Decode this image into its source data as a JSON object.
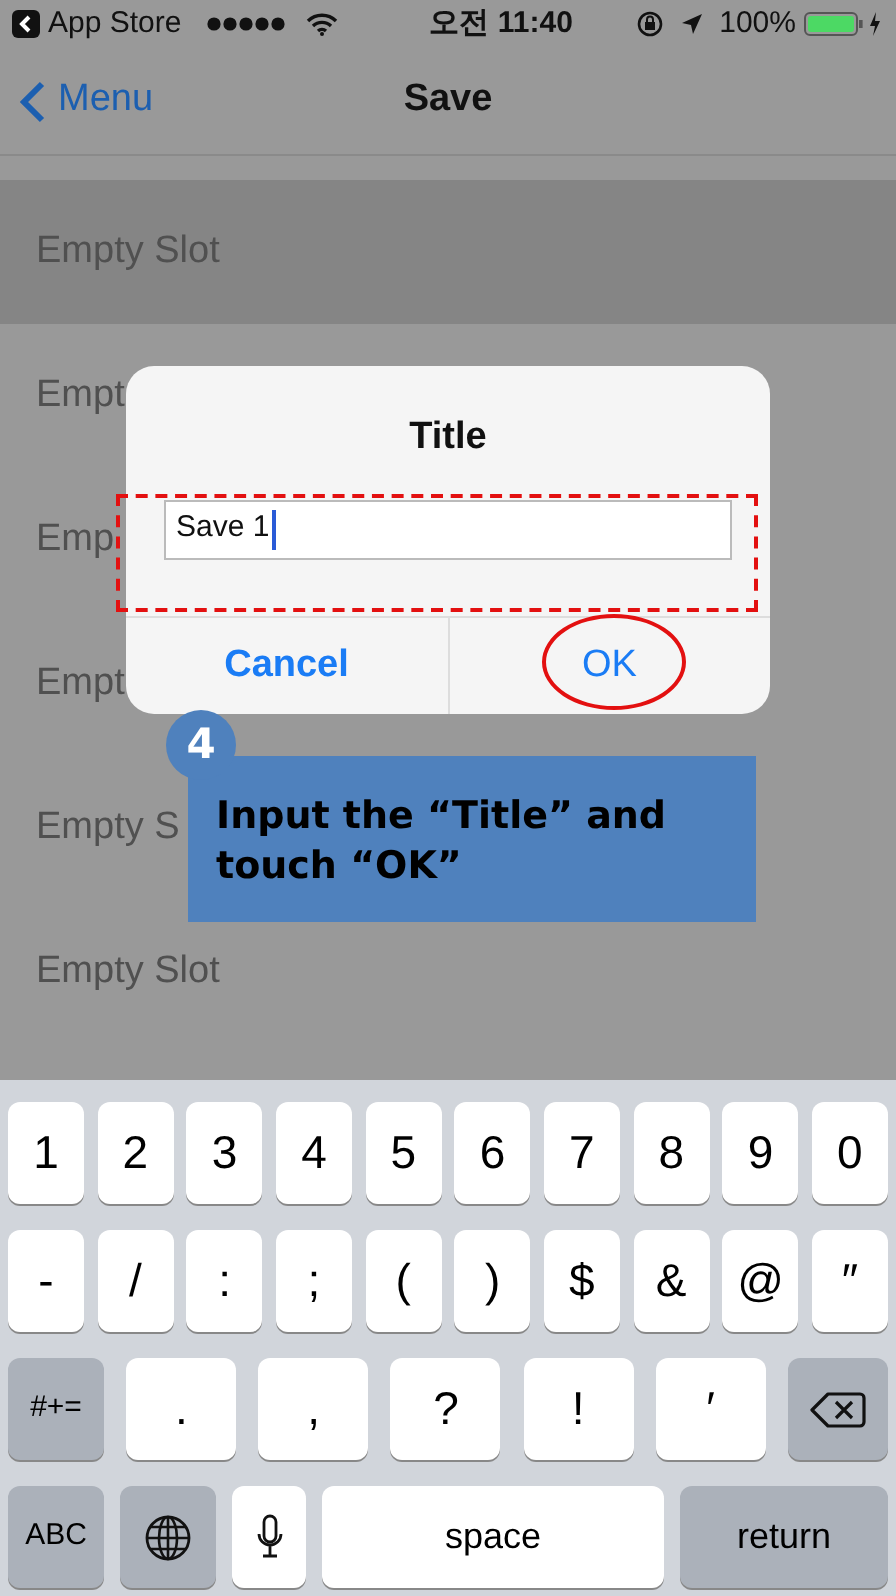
{
  "status_bar": {
    "back_app": "App Store",
    "time": "오전 11:40",
    "battery": "100%"
  },
  "nav": {
    "back": "Menu",
    "title": "Save"
  },
  "slots": [
    {
      "label": "Empty Slot",
      "selected": true
    },
    {
      "label": "Empt",
      "selected": false
    },
    {
      "label": "Emp",
      "selected": false
    },
    {
      "label": "Empt",
      "selected": false
    },
    {
      "label": "Empty S",
      "selected": false
    },
    {
      "label": "Empty Slot",
      "selected": false
    }
  ],
  "dialog": {
    "title": "Title",
    "value": "Save 1",
    "buttons": [
      "Cancel",
      "OK"
    ]
  },
  "callout": {
    "step": "4",
    "text": "Input the “Title” and touch “OK”"
  },
  "keyboard": [
    [
      {
        "label": "1",
        "kind": "char"
      },
      {
        "label": "2",
        "kind": "char"
      },
      {
        "label": "3",
        "kind": "char"
      },
      {
        "label": "4",
        "kind": "char"
      },
      {
        "label": "5",
        "kind": "char"
      },
      {
        "label": "6",
        "kind": "char"
      },
      {
        "label": "7",
        "kind": "char"
      },
      {
        "label": "8",
        "kind": "char"
      },
      {
        "label": "9",
        "kind": "char"
      },
      {
        "label": "0",
        "kind": "char"
      }
    ],
    [
      {
        "label": "-",
        "kind": "char"
      },
      {
        "label": "/",
        "kind": "char"
      },
      {
        "label": ":",
        "kind": "char"
      },
      {
        "label": ";",
        "kind": "char"
      },
      {
        "label": "(",
        "kind": "char"
      },
      {
        "label": ")",
        "kind": "char"
      },
      {
        "label": "$",
        "kind": "char"
      },
      {
        "label": "&",
        "kind": "char"
      },
      {
        "label": "@",
        "kind": "char"
      },
      {
        "label": "″",
        "kind": "char"
      }
    ],
    [
      {
        "label": "#+=",
        "kind": "function"
      },
      {
        "label": ".",
        "kind": "wide"
      },
      {
        "label": ",",
        "kind": "wide"
      },
      {
        "label": "?",
        "kind": "wide"
      },
      {
        "label": "!",
        "kind": "wide"
      },
      {
        "label": "′",
        "kind": "wide"
      },
      {
        "kind": "delete"
      }
    ],
    [
      {
        "label": "ABC",
        "kind": "function"
      },
      {
        "kind": "globe"
      },
      {
        "kind": "mic"
      },
      {
        "label": "space",
        "kind": "space"
      },
      {
        "label": "return",
        "kind": "return"
      }
    ]
  ]
}
